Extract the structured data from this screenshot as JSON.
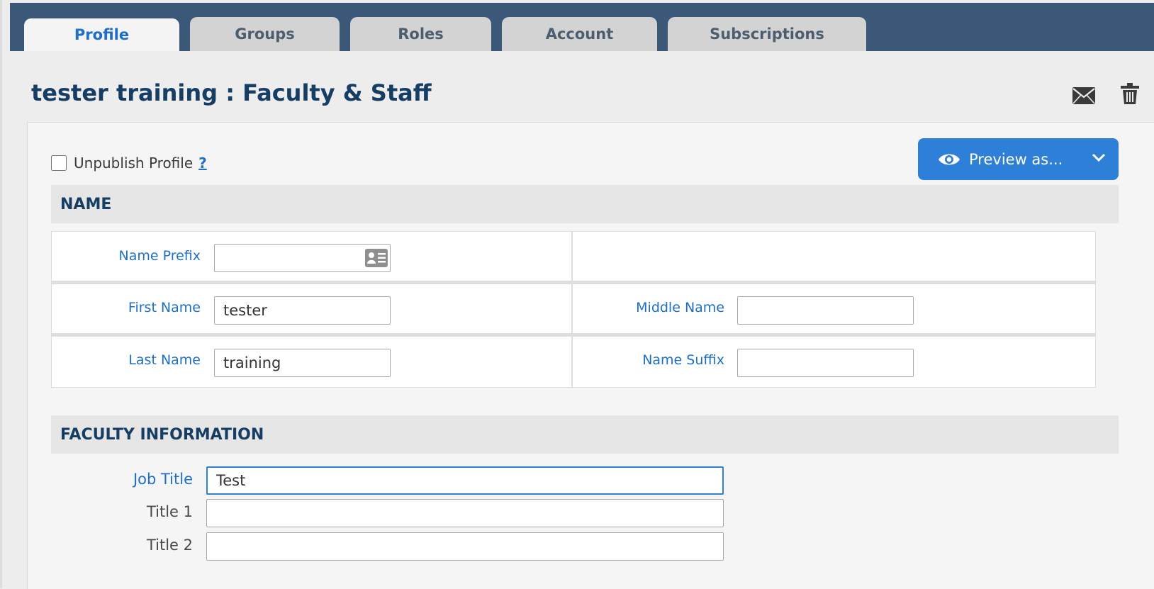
{
  "tabs": [
    {
      "label": "Profile",
      "active": true
    },
    {
      "label": "Groups",
      "active": false
    },
    {
      "label": "Roles",
      "active": false
    },
    {
      "label": "Account",
      "active": false
    },
    {
      "label": "Subscriptions",
      "active": false
    }
  ],
  "page_title": "tester training : Faculty & Staff",
  "header_icons": [
    "envelope-icon",
    "trash-icon"
  ],
  "unpublish": {
    "label": "Unpublish Profile",
    "checked": false,
    "help": "?"
  },
  "preview": {
    "label": "Preview as...",
    "icon": "eye-icon",
    "dropdown_icon": "chevron-down-icon"
  },
  "sections": {
    "name": {
      "title": "NAME",
      "fields": {
        "name_prefix": {
          "label": "Name Prefix",
          "value": ""
        },
        "first_name": {
          "label": "First Name",
          "value": "tester"
        },
        "middle_name": {
          "label": "Middle Name",
          "value": ""
        },
        "last_name": {
          "label": "Last Name",
          "value": "training"
        },
        "name_suffix": {
          "label": "Name Suffix",
          "value": ""
        }
      }
    },
    "faculty": {
      "title": "FACULTY INFORMATION",
      "fields": {
        "job_title": {
          "label": "Job Title",
          "value": "Test"
        },
        "title_1": {
          "label": "Title 1",
          "value": ""
        },
        "title_2": {
          "label": "Title 2",
          "value": ""
        }
      }
    }
  },
  "colors": {
    "top_bar": "#3b5878",
    "accent": "#2e7fd8",
    "label_blue": "#1f6fc6",
    "title_navy": "#163d63"
  }
}
